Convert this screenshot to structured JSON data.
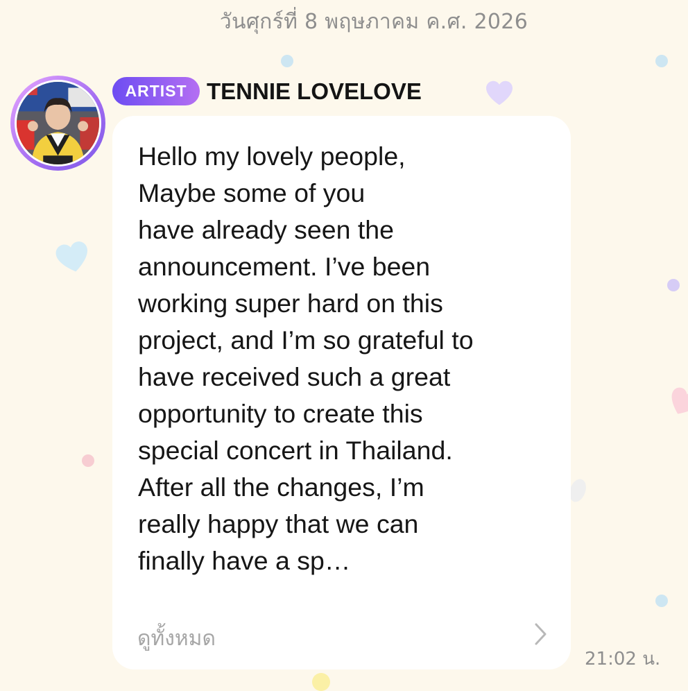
{
  "chat": {
    "date_header": "วันศุกร์ที่ 8 พฤษภาคม ค.ศ. 2026",
    "message": {
      "badge": "ARTIST",
      "sender": "TENNIE LOVELOVE",
      "text": " Hello my lovely people,\nMaybe some of you\nhave already seen the\nannouncement. I’ve been\nworking super hard on this\nproject, and I’m so grateful to\nhave received such a great\nopportunity to create this\nspecial concert in Thailand.\nAfter all the changes, I’m\nreally happy that we can\nfinally have a sp…",
      "see_all": "ดูทั้งหมด",
      "time": "21:02 น."
    }
  },
  "icons": {
    "avatar": "artist-avatar-photo",
    "chevron": "chevron-right-icon"
  },
  "colors": {
    "background": "#fdf8ec",
    "bubble": "#ffffff",
    "badge_start": "#6d4df2",
    "badge_end": "#b46ff2",
    "muted_text": "#8e8e8e"
  }
}
